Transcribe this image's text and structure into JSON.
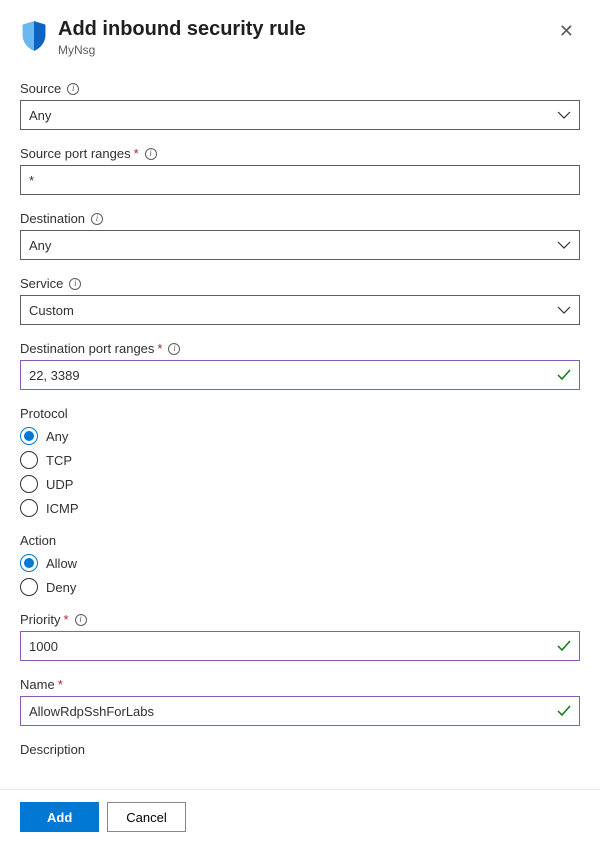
{
  "header": {
    "title": "Add inbound security rule",
    "subtitle": "MyNsg"
  },
  "fields": {
    "source": {
      "label": "Source",
      "value": "Any"
    },
    "sourcePortRanges": {
      "label": "Source port ranges",
      "value": "*"
    },
    "destination": {
      "label": "Destination",
      "value": "Any"
    },
    "service": {
      "label": "Service",
      "value": "Custom"
    },
    "destPortRanges": {
      "label": "Destination port ranges",
      "value": "22, 3389"
    },
    "protocol": {
      "label": "Protocol",
      "options": [
        "Any",
        "TCP",
        "UDP",
        "ICMP"
      ],
      "selected": "Any"
    },
    "action": {
      "label": "Action",
      "options": [
        "Allow",
        "Deny"
      ],
      "selected": "Allow"
    },
    "priority": {
      "label": "Priority",
      "value": "1000"
    },
    "name": {
      "label": "Name",
      "value": "AllowRdpSshForLabs"
    },
    "description": {
      "label": "Description"
    }
  },
  "footer": {
    "add": "Add",
    "cancel": "Cancel"
  }
}
